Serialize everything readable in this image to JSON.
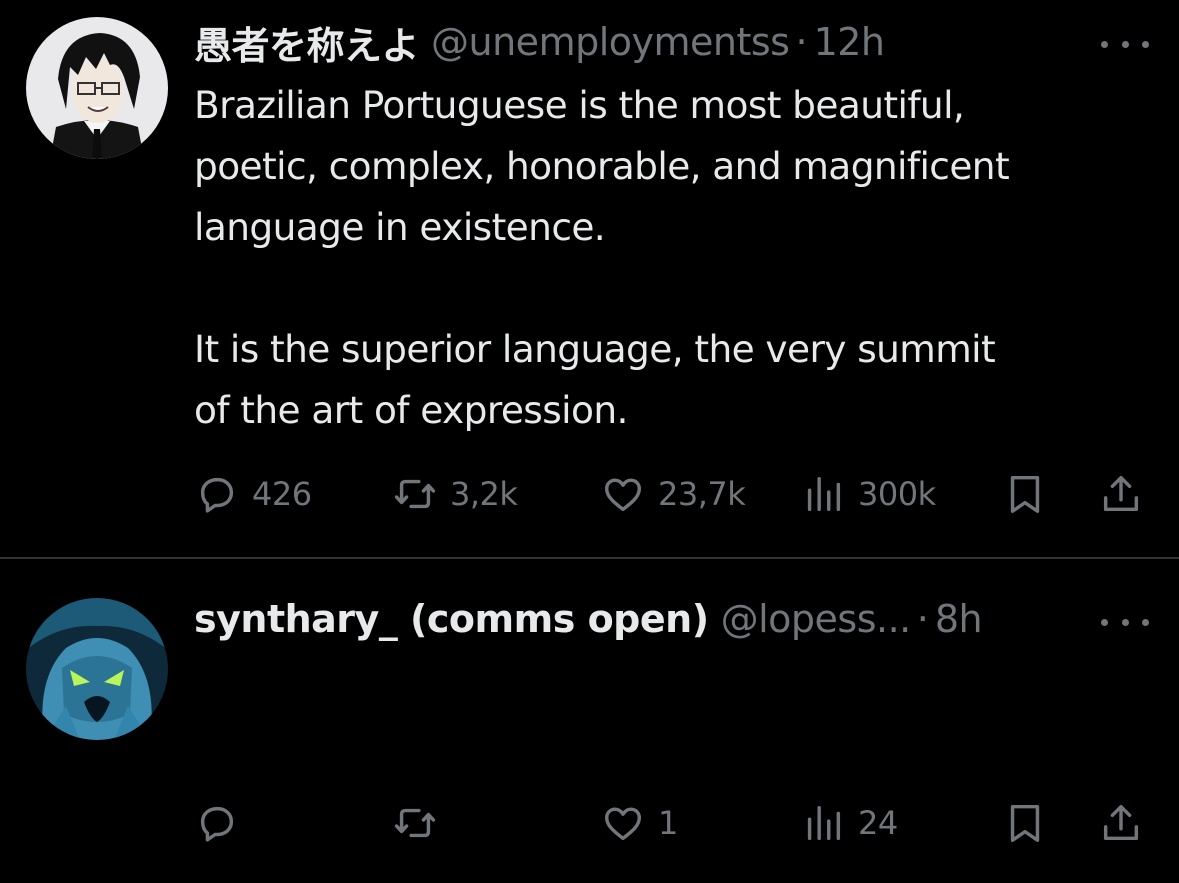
{
  "tweets": [
    {
      "display_name": "愚者を称えよ",
      "handle": "@unemploymentss",
      "separator": "·",
      "time": "12h",
      "text_lines": [
        "Brazilian Portuguese is the most beautiful,",
        "poetic, complex, honorable, and magnificent",
        "language in existence.",
        "",
        "It is the superior language, the very summit",
        "of the art of expression."
      ],
      "actions": {
        "replies": "426",
        "reposts": "3,2k",
        "likes": "23,7k",
        "views": "300k"
      },
      "icons": [
        "reply-icon",
        "repost-icon",
        "like-icon",
        "views-icon",
        "bookmark-icon",
        "share-icon"
      ]
    },
    {
      "display_name": "synthary_ (comms open)",
      "handle": "@lopess...",
      "separator": "·",
      "time": "8h",
      "actions": {
        "replies": "",
        "reposts": "",
        "likes": "1",
        "views": "24"
      },
      "icons": [
        "reply-icon",
        "repost-icon",
        "like-icon",
        "views-icon",
        "bookmark-icon",
        "share-icon"
      ]
    }
  ],
  "colors": {
    "background": "#000000",
    "text_primary": "#e7e9ea",
    "text_secondary": "#71767b",
    "divider": "#2f3336"
  }
}
